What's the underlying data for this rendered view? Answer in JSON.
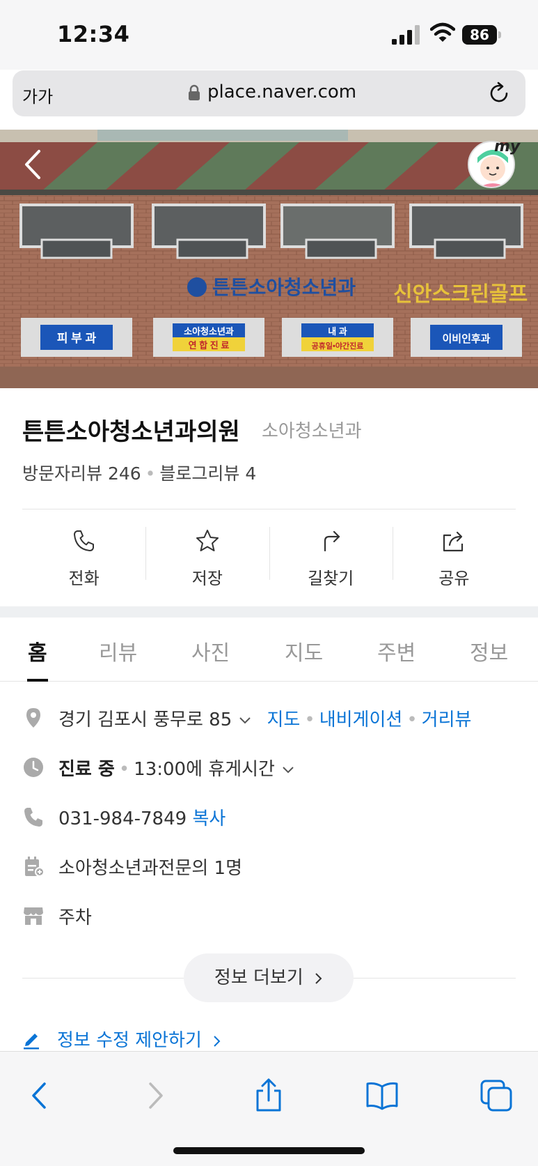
{
  "status_bar": {
    "time": "12:34",
    "battery_level": "86"
  },
  "address_bar": {
    "text_size_label": "가가",
    "url": "place.naver.com"
  },
  "place": {
    "name": "튼튼소아청소년과의원",
    "category": "소아청소년과",
    "visitor_reviews": "방문자리뷰 246",
    "blog_reviews": "블로그리뷰 4"
  },
  "actions": [
    {
      "label": "전화",
      "icon": "phone-icon"
    },
    {
      "label": "저장",
      "icon": "star-icon"
    },
    {
      "label": "길찾기",
      "icon": "directions-icon"
    },
    {
      "label": "공유",
      "icon": "share-icon"
    }
  ],
  "tabs": [
    {
      "label": "홈",
      "active": true
    },
    {
      "label": "리뷰"
    },
    {
      "label": "사진"
    },
    {
      "label": "지도"
    },
    {
      "label": "주변"
    },
    {
      "label": "정보"
    }
  ],
  "info": {
    "address": "경기 김포시 풍무로 85",
    "map_link": "지도",
    "navigation_link": "내비게이션",
    "street_view_link": "거리뷰",
    "status": "진료 중",
    "break_time": "13:00에 휴게시간",
    "phone": "031-984-7849",
    "copy_link": "복사",
    "doctors": "소아청소년과전문의 1명",
    "parking": "주차"
  },
  "more_info_label": "정보 더보기",
  "suggest_edit_label": "정보 수정 제안하기",
  "hero_signs": {
    "sign1": "피 부 과",
    "sign2_top": "소아청소년과",
    "sign2_bottom": "연 합 진 료",
    "sign3_top": "내 과",
    "sign3_bottom": "공휴일•야간진료",
    "sign4": "이비인후과",
    "building_sign": "튼튼소아청소년과",
    "neighbor_sign": "신안스크린골프"
  },
  "avatar_label": "my",
  "colors": {
    "link": "#0a74d6",
    "text_primary": "#111111",
    "text_muted": "#999999"
  }
}
